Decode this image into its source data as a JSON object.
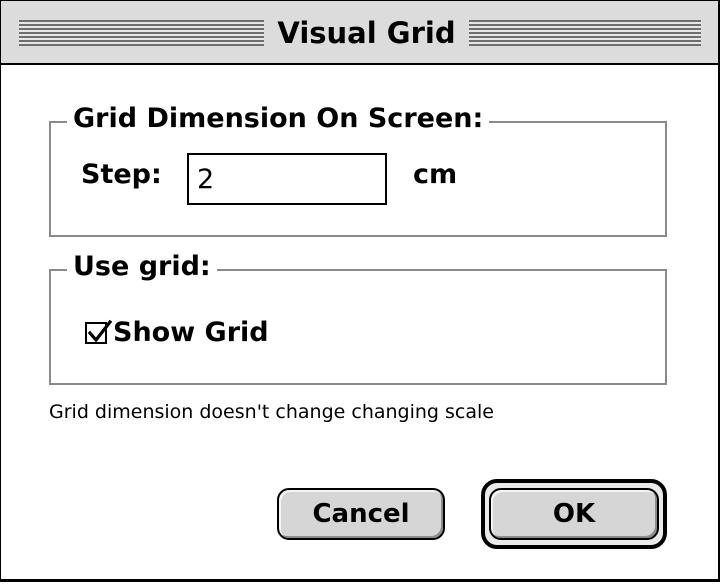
{
  "window": {
    "title": "Visual Grid"
  },
  "grid_dimension": {
    "group_title": "Grid Dimension On Screen:",
    "step_label": "Step:",
    "step_value": "2",
    "unit": "cm"
  },
  "use_grid": {
    "group_title": "Use grid:",
    "show_grid_label": "Show Grid",
    "show_grid_checked": true
  },
  "note": "Grid dimension doesn't change changing scale",
  "buttons": {
    "cancel": "Cancel",
    "ok": "OK"
  },
  "icons": {
    "checkbox": "checkmark-icon"
  }
}
